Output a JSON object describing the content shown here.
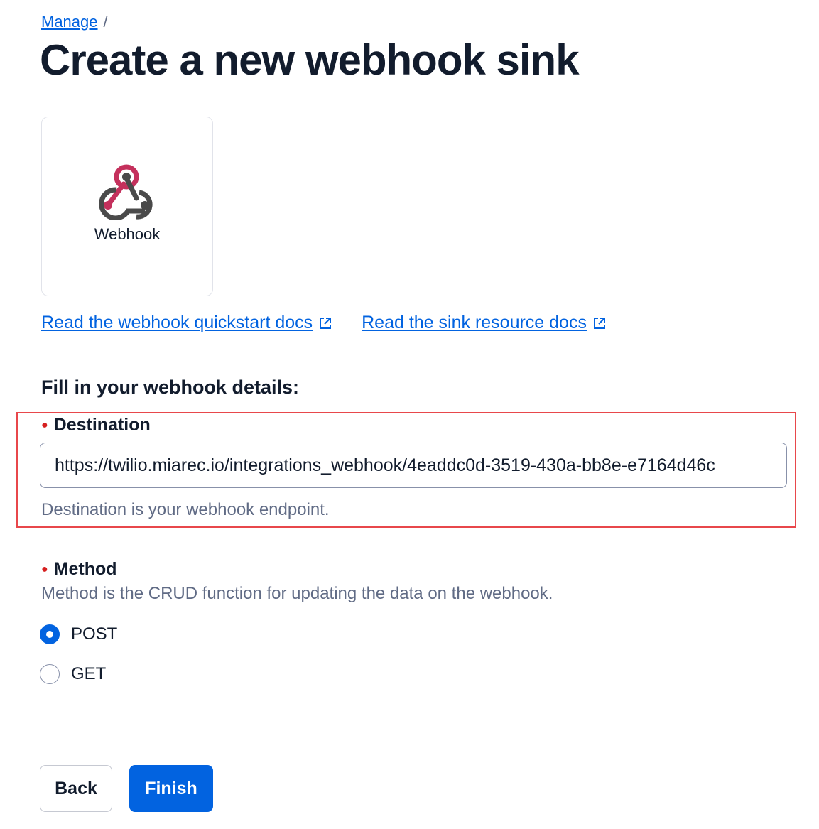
{
  "breadcrumb": {
    "link": "Manage",
    "separator": "/"
  },
  "page_title": "Create a new webhook sink",
  "card": {
    "label": "Webhook",
    "icon": "webhook-icon"
  },
  "doc_links": [
    {
      "label": "Read the webhook quickstart docs",
      "icon": "external-link-icon"
    },
    {
      "label": "Read the sink resource docs",
      "icon": "external-link-icon"
    }
  ],
  "form": {
    "section_title": "Fill in your webhook details:",
    "destination": {
      "label": "Destination",
      "value": "https://twilio.miarec.io/integrations_webhook/4eaddc0d-3519-430a-bb8e-e7164d46c",
      "help": "Destination is your webhook endpoint."
    },
    "method": {
      "label": "Method",
      "help": "Method is the CRUD function for updating the data on the webhook.",
      "options": [
        {
          "label": "POST",
          "checked": true
        },
        {
          "label": "GET",
          "checked": false
        }
      ]
    }
  },
  "buttons": {
    "back": "Back",
    "finish": "Finish"
  },
  "colors": {
    "link": "#0263e0",
    "primary": "#0263e0",
    "required": "#d61f1f",
    "highlight": "#e8474b"
  }
}
